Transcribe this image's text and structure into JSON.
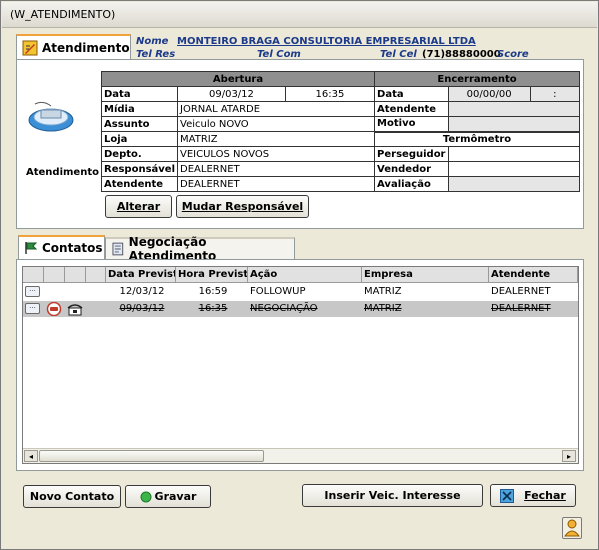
{
  "window": {
    "title": "(W_ATENDIMENTO)"
  },
  "top_tab": {
    "label": "Atendimento"
  },
  "customer": {
    "nome_label": "Nome",
    "nome_value": "MONTEIRO BRAGA CONSULTORIA EMPRESARIAL LTDA",
    "telres_label": "Tel Res",
    "telcom_label": "Tel Com",
    "telcel_label": "Tel Cel",
    "telcel_value": "(71)88880000",
    "score_label": "Score"
  },
  "side": {
    "label": "Atendimento"
  },
  "abertura": {
    "header": "Abertura",
    "data_label": "Data",
    "data_value": "09/03/12",
    "hora_value": "16:35",
    "midia_label": "Mídia",
    "midia_value": "JORNAL ATARDE",
    "assunto_label": "Assunto",
    "assunto_value": "Veiculo NOVO",
    "loja_label": "Loja",
    "loja_value": "MATRIZ",
    "depto_label": "Depto.",
    "depto_value": "VEICULOS NOVOS",
    "responsavel_label": "Responsável",
    "responsavel_value": "DEALERNET",
    "atendente_label": "Atendente",
    "atendente_value": "DEALERNET"
  },
  "encerramento": {
    "header": "Encerramento",
    "data_label": "Data",
    "data_value": "00/00/00",
    "hora_value": ":",
    "atendente_label": "Atendente",
    "motivo_label": "Motivo"
  },
  "termometro": {
    "header": "Termômetro",
    "perseguidor_label": "Perseguidor",
    "vendedor_label": "Vendedor",
    "avaliacao_label": "Avaliação"
  },
  "buttons": {
    "alterar": "Alterar",
    "mudar_responsavel": "Mudar Responsável",
    "novo_contato": "Novo Contato",
    "gravar": "Gravar",
    "inserir_veic": "Inserir Veic. Interesse",
    "fechar": "Fechar"
  },
  "lower_tabs": {
    "contatos": "Contatos",
    "negociacao": "Negociação Atendimento"
  },
  "contatos_table": {
    "columns": [
      "Data Prevista",
      "Hora Prevista",
      "Ação",
      "Empresa",
      "Atendente"
    ],
    "rows": [
      {
        "data": "12/03/12",
        "hora": "16:59",
        "acao": "FOLLOWUP",
        "empresa": "MATRIZ",
        "atendente": "DEALERNET"
      },
      {
        "data": "09/03/12",
        "hora": "16:35",
        "acao": "NEGOCIAÇÃO",
        "empresa": "MATRIZ",
        "atendente": "DEALERNET"
      }
    ]
  },
  "colors": {
    "link_blue": "#1c3a8a",
    "tab_accent": "#f2a23a",
    "selected_row": "#c7c7c7"
  }
}
